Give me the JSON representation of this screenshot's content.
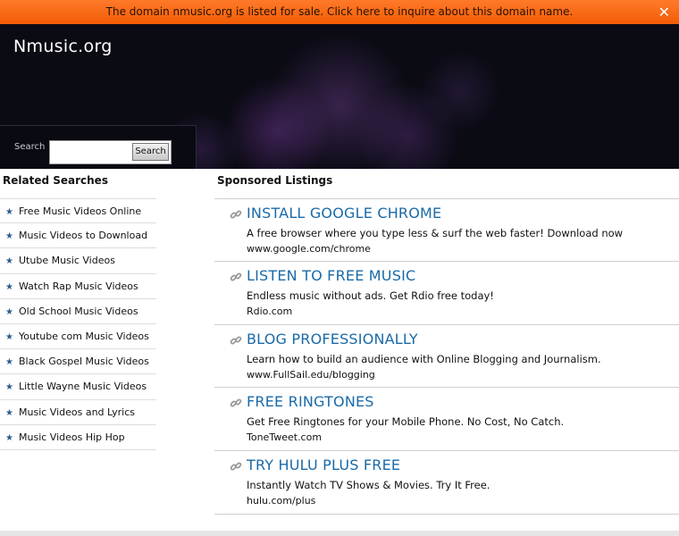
{
  "topbar": {
    "message": "The domain nmusic.org is listed for sale. Click here to inquire about this domain name.",
    "close_label": "✕"
  },
  "header": {
    "site_title": "Nmusic.org",
    "search_label": "Search",
    "search_button": "Search",
    "search_value": ""
  },
  "related": {
    "heading": "Related Searches",
    "items": [
      "Free Music Videos Online",
      "Music Videos to Download",
      "Utube Music Videos",
      "Watch Rap Music Videos",
      "Old School Music Videos",
      "Youtube com Music Videos",
      "Black Gospel Music Videos",
      "Little Wayne Music Videos",
      "Music Videos and Lyrics",
      "Music Videos Hip Hop"
    ]
  },
  "sponsored": {
    "heading": "Sponsored Listings",
    "listings": [
      {
        "title": "INSTALL GOOGLE CHROME",
        "desc": "A free browser where you type less & surf the web faster! Download now",
        "url": "www.google.com/chrome"
      },
      {
        "title": "LISTEN TO FREE MUSIC",
        "desc": "Endless music without ads. Get Rdio free today!",
        "url": "Rdio.com"
      },
      {
        "title": "BLOG PROFESSIONALLY",
        "desc": "Learn how to build an audience with Online Blogging and Journalism.",
        "url": "www.FullSail.edu/blogging"
      },
      {
        "title": "FREE RINGTONES",
        "desc": "Get Free Ringtones for your Mobile Phone. No Cost, No Catch.",
        "url": "ToneTweet.com"
      },
      {
        "title": "TRY HULU PLUS FREE",
        "desc": "Instantly Watch TV Shows & Movies. Try It Free.",
        "url": "hulu.com/plus"
      }
    ]
  },
  "colors": {
    "topbar": "#f25c05",
    "header_bg": "#0b0b14",
    "link": "#1a6aa8",
    "star": "#2d5c8c"
  }
}
